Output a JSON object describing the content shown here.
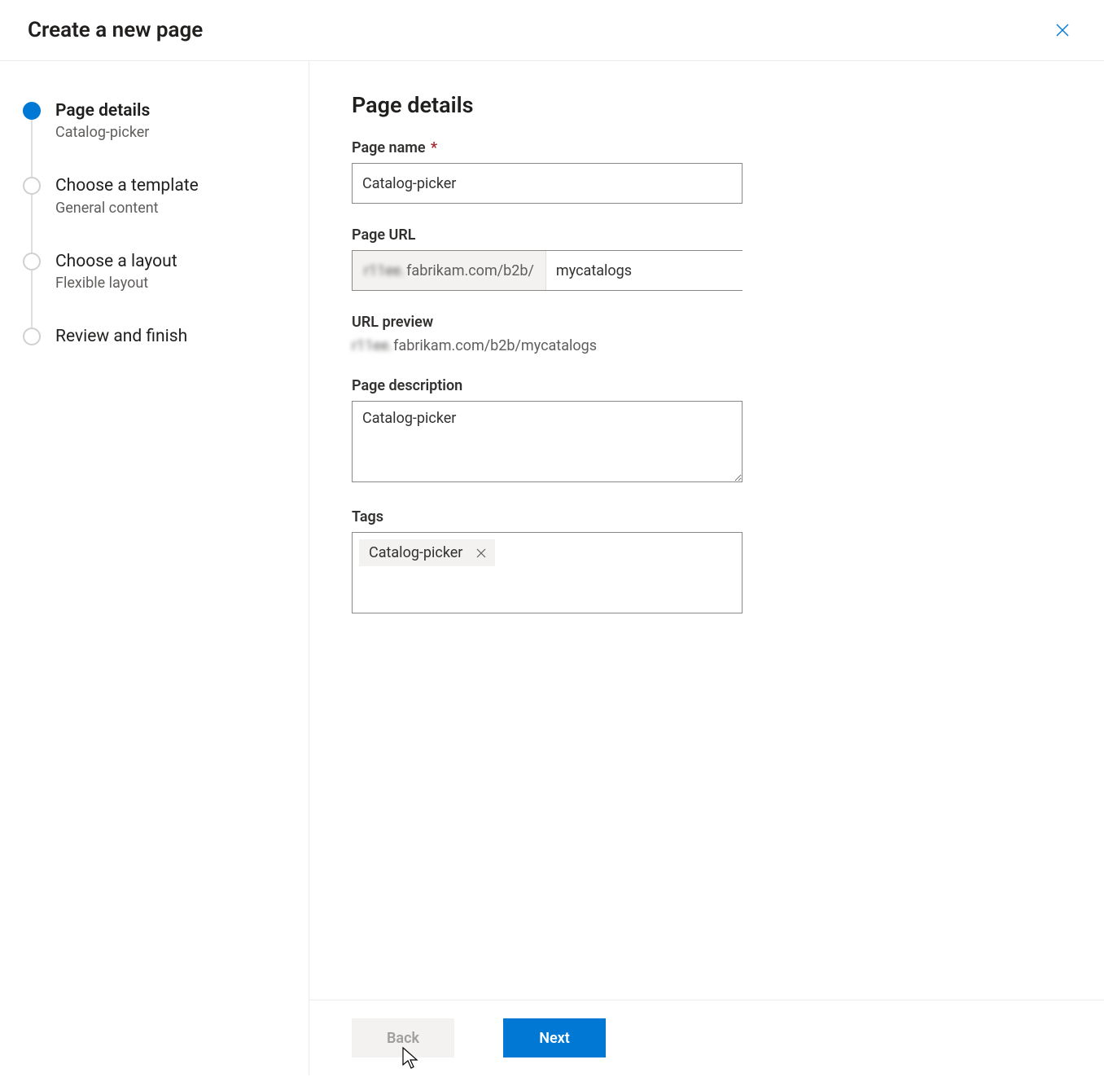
{
  "header": {
    "title": "Create a new page"
  },
  "steps": [
    {
      "title": "Page details",
      "sub": "Catalog-picker",
      "active": true
    },
    {
      "title": "Choose a template",
      "sub": "General content",
      "active": false
    },
    {
      "title": "Choose a layout",
      "sub": "Flexible layout",
      "active": false
    },
    {
      "title": "Review and finish",
      "sub": "",
      "active": false
    }
  ],
  "form": {
    "heading": "Page details",
    "pageName": {
      "label": "Page name",
      "required": true,
      "value": "Catalog-picker"
    },
    "pageUrl": {
      "label": "Page URL",
      "prefix_visible": "fabrikam.com/b2b/",
      "value": "mycatalogs"
    },
    "urlPreview": {
      "label": "URL preview",
      "value_visible": "fabrikam.com/b2b/mycatalogs"
    },
    "description": {
      "label": "Page description",
      "value": "Catalog-picker"
    },
    "tags": {
      "label": "Tags",
      "items": [
        "Catalog-picker"
      ]
    }
  },
  "footer": {
    "back": "Back",
    "next": "Next"
  }
}
